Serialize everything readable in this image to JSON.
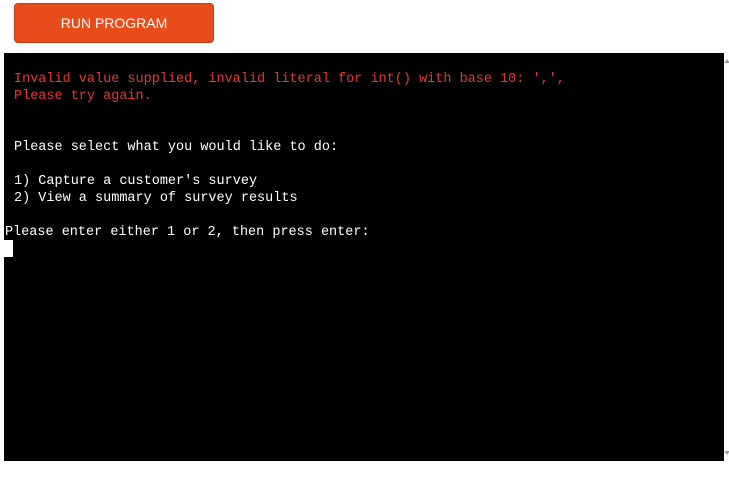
{
  "toolbar": {
    "run_label": "RUN PROGRAM"
  },
  "terminal": {
    "error_line_1": "Invalid value supplied, invalid literal for int() with base 10: ',',",
    "error_line_2": "Please try again.",
    "prompt_heading": "Please select what you would like to do:",
    "option_1": "1) Capture a customer's survey",
    "option_2": "2) View a summary of survey results",
    "input_prompt": "Please enter either 1 or 2, then press enter:"
  },
  "colors": {
    "button": "#e84c1a",
    "error_text": "#e53935",
    "terminal_bg": "#000000",
    "terminal_text": "#ffffff"
  }
}
